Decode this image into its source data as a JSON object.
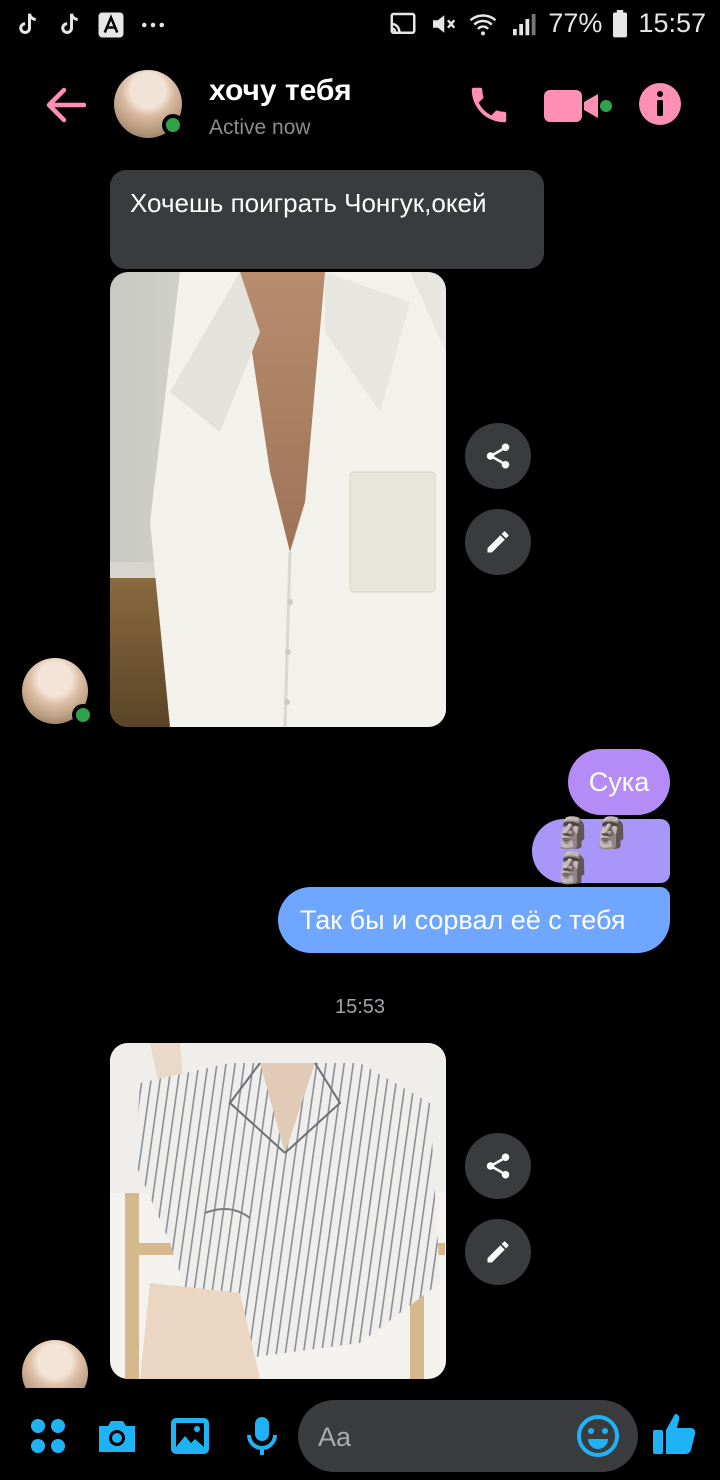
{
  "status_bar": {
    "battery_percent": "77%",
    "time": "15:57",
    "left_icons": [
      "tiktok-icon",
      "tiktok-icon",
      "translate-icon",
      "more-notifications-icon"
    ],
    "right_icons": [
      "cast-icon",
      "mute-icon",
      "wifi-icon",
      "signal-icon",
      "battery-icon"
    ]
  },
  "header": {
    "contact_name": "хочу тебя",
    "presence": "Active now",
    "accent_color": "#ff8fb5",
    "online_color": "#31a24c"
  },
  "messages": [
    {
      "type": "text",
      "direction": "incoming",
      "text": "Хочешь поиграть Чонгук,окей"
    },
    {
      "type": "photo",
      "direction": "incoming",
      "description_icon": "photo-white-shirt"
    },
    {
      "type": "text",
      "direction": "outgoing",
      "text": "Сука"
    },
    {
      "type": "emoji",
      "direction": "outgoing",
      "text": "🗿🗿🗿"
    },
    {
      "type": "text",
      "direction": "outgoing",
      "text": "Так бы и сорвал её с тебя"
    },
    {
      "type": "photo",
      "direction": "incoming",
      "description_icon": "photo-striped-pajama"
    }
  ],
  "timestamp": "15:53",
  "composer": {
    "placeholder": "Aa",
    "icons": [
      "apps-icon",
      "camera-icon",
      "gallery-icon",
      "microphone-icon",
      "emoji-icon",
      "like-icon"
    ],
    "icon_color": "#1fb3f5"
  },
  "outgoing_gradient": [
    "#b58cf5",
    "#6fa6ff"
  ]
}
